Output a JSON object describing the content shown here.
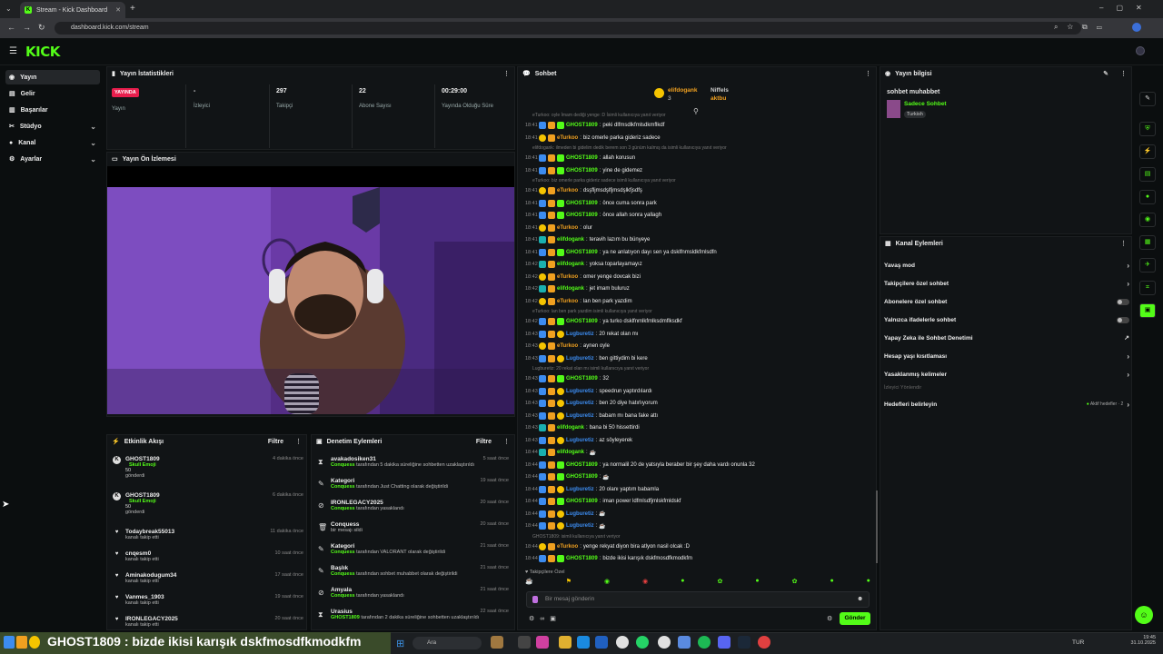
{
  "browser": {
    "tab_title": "Stream - Kick Dashboard",
    "url": "dashboard.kick.com/stream"
  },
  "brand": {
    "logo": "KICK",
    "accent": "#53fc18"
  },
  "sidebar": {
    "items": [
      {
        "label": "Yayın"
      },
      {
        "label": "Gelir"
      },
      {
        "label": "Başarılar"
      },
      {
        "label": "Stüdyo"
      },
      {
        "label": "Kanal"
      },
      {
        "label": "Ayarlar"
      }
    ]
  },
  "stats": {
    "title": "Yayın İstatistikleri",
    "live_badge": "YAYINDA",
    "items": [
      {
        "value": "",
        "label": "Yayın"
      },
      {
        "value": "-",
        "label": "İzleyici"
      },
      {
        "value": "297",
        "label": "Takipçi"
      },
      {
        "value": "22",
        "label": "Abone Sayısı"
      },
      {
        "value": "00:29:00",
        "label": "Yayında Olduğu Süre"
      }
    ]
  },
  "preview": {
    "title": "Yayın Ön İzlemesi"
  },
  "activity": {
    "title": "Etkinlik Akışı",
    "filter": "Filtre",
    "items": [
      {
        "user": "GHOST1809",
        "sub": "Skull Emoji",
        "amount": "50",
        "note": "gönderdi",
        "time": "4 dakika önce",
        "icon": "kick-icon"
      },
      {
        "user": "GHOST1809",
        "sub": "Skull Emoji",
        "amount": "50",
        "note": "gönderdi",
        "time": "6 dakika önce",
        "icon": "kick-icon"
      },
      {
        "user": "Todaybreak55013",
        "note": "kanalı takip etti",
        "time": "11 dakika önce",
        "icon": "heart-icon"
      },
      {
        "user": "cnqesm0",
        "note": "kanalı takip etti",
        "time": "10 saat önce",
        "icon": "heart-icon"
      },
      {
        "user": "Aminakodugum34",
        "note": "kanalı takip etti",
        "time": "17 saat önce",
        "icon": "heart-icon"
      },
      {
        "user": "Vanmes_1903",
        "note": "kanalı takip etti",
        "time": "19 saat önce",
        "icon": "heart-icon"
      },
      {
        "user": "IRONLEGACY2025",
        "note": "kanalı takip etti",
        "time": "20 saat önce",
        "icon": "heart-icon"
      }
    ]
  },
  "moderation": {
    "title": "Denetim Eylemleri",
    "filter": "Filtre",
    "items": [
      {
        "title": "avakadosiken31",
        "actor": "Conquess",
        "desc": "tarafından 5 dakika süreliğine sohbetten uzaklaştırıldı",
        "time": "5 saat önce"
      },
      {
        "title": "Kategori",
        "actor": "Conquess",
        "desc": "tarafından Just Chatting olarak değiştirildi",
        "time": "19 saat önce"
      },
      {
        "title": "IRONLEGACY2025",
        "actor": "Conquess",
        "desc": "tarafından yasaklandı",
        "time": "20 saat önce"
      },
      {
        "title": "Conquess",
        "actor": "",
        "desc": "bir mesajı sildi",
        "time": "20 saat önce"
      },
      {
        "title": "Kategori",
        "actor": "Conquess",
        "desc": "tarafından VALORANT olarak değiştirildi",
        "time": "21 saat önce"
      },
      {
        "title": "Başlık",
        "actor": "Conquess",
        "desc": "tarafından sohbet muhabbet olarak değiştirildi",
        "time": "21 saat önce"
      },
      {
        "title": "Amyala",
        "actor": "Conquess",
        "desc": "tarafından yasaklandı",
        "time": "21 saat önce"
      },
      {
        "title": "Urasius",
        "actor": "GHOST1809",
        "desc": "tarafından 2 dakika süreliğine sohbetten uzaklaştırıldı",
        "time": "22 saat önce"
      }
    ]
  },
  "chat": {
    "title": "Sohbet",
    "pinned": [
      {
        "user": "elifdogank",
        "count": "3"
      },
      {
        "user": "Niffels",
        "count": "1"
      },
      {
        "user": "aktbu",
        "count": "1"
      }
    ],
    "messages": [
      {
        "t": "18:41",
        "u": "GHOST1809",
        "c": "#53fc18",
        "m": "peki dlfmsdlkfmlsdkmflkdf",
        "r": "eTurkoo: oyle İmam dediği yenge :D İsimli kullanıcıya yanıt veriyor"
      },
      {
        "t": "18:41",
        "u": "eTurkoo",
        "c": "#f0a020",
        "m": "biz omerle parka gideriz sadece"
      },
      {
        "t": "18:41",
        "u": "GHOST1809",
        "c": "#53fc18",
        "m": "allah korusun",
        "r": "elifdogank: ilmeden bi gidelim dedik berem son 3 günüm kalmış da isimli kullanıcıya yanıt veriyor"
      },
      {
        "t": "18:41",
        "u": "GHOST1809",
        "c": "#53fc18",
        "m": "yine de gidemez"
      },
      {
        "t": "18:41",
        "u": "eTurkoo",
        "c": "#f0a020",
        "m": "dsşfljmsdşlfjmsdşlkfjsdfş",
        "r": "eTurkoo: biz omerle parka gideriz sadece isimli kullanıcıya yanıt veriyor"
      },
      {
        "t": "18:41",
        "u": "GHOST1809",
        "c": "#53fc18",
        "m": "önce cuma sonra park"
      },
      {
        "t": "18:41",
        "u": "GHOST1809",
        "c": "#53fc18",
        "m": "önce allah sonra yallagh"
      },
      {
        "t": "18:41",
        "u": "eTurkoo",
        "c": "#f0a020",
        "m": "olur"
      },
      {
        "t": "18:41",
        "u": "elifdogank",
        "c": "#53fc18",
        "m": "teravih lazım bu bünyeye"
      },
      {
        "t": "18:41",
        "u": "GHOST1809",
        "c": "#53fc18",
        "m": "ya ne anlatıyon dayı sen ya dsklfnmsldkfmlsdfn"
      },
      {
        "t": "18:42",
        "u": "elifdogank",
        "c": "#53fc18",
        "m": "yoksa toparlayamayız"
      },
      {
        "t": "18:42",
        "u": "eTurkoo",
        "c": "#f0a020",
        "m": "omer yenge dovcak bizi"
      },
      {
        "t": "18:42",
        "u": "elifdogank",
        "c": "#53fc18",
        "m": "jet imam buluruz"
      },
      {
        "t": "18:42",
        "u": "eTurkoo",
        "c": "#f0a020",
        "m": "lan ben park yazdim"
      },
      {
        "t": "18:42",
        "u": "GHOST1809",
        "c": "#53fc18",
        "m": "ya turko dsklfnmlkfmlksdmflksdkf",
        "r": "eTurkoo: lan ben park yazdim isimli kullanıcıya yanıt veriyor"
      },
      {
        "t": "18:43",
        "u": "Lugburetiz",
        "c": "#3c8cf0",
        "m": "20 rekat olan mı"
      },
      {
        "t": "18:43",
        "u": "eTurkoo",
        "c": "#f0a020",
        "m": "aynen oyle"
      },
      {
        "t": "18:43",
        "u": "Lugburetiz",
        "c": "#3c8cf0",
        "m": "ben gittiydim bi kere"
      },
      {
        "t": "18:43",
        "u": "GHOST1809",
        "c": "#53fc18",
        "m": "32",
        "r": "Lugburetiz: 20 rekat olan mı isimli kullanıcıya yanıt veriyor"
      },
      {
        "t": "18:43",
        "u": "Lugburetiz",
        "c": "#3c8cf0",
        "m": "speedrun yaptırdılardı"
      },
      {
        "t": "18:43",
        "u": "Lugburetiz",
        "c": "#3c8cf0",
        "m": "ben 20 diye hatırlıyorum"
      },
      {
        "t": "18:43",
        "u": "Lugburetiz",
        "c": "#3c8cf0",
        "m": "babam mı bana fake attı"
      },
      {
        "t": "18:43",
        "u": "elifdogank",
        "c": "#53fc18",
        "m": "bana bi 50 hissettirdi"
      },
      {
        "t": "18:43",
        "u": "Lugburetiz",
        "c": "#3c8cf0",
        "m": "az söyleyerek"
      },
      {
        "t": "18:44",
        "u": "elifdogank",
        "c": "#53fc18",
        "m": "☕"
      },
      {
        "t": "18:44",
        "u": "GHOST1809",
        "c": "#53fc18",
        "m": "ya normalil 20 de yatsıyla beraber bir şey daha vardı onunla 32"
      },
      {
        "t": "18:44",
        "u": "GHOST1809",
        "c": "#53fc18",
        "m": "☕"
      },
      {
        "t": "18:44",
        "u": "Lugburetiz",
        "c": "#3c8cf0",
        "m": "20 olanı yaptım babamla"
      },
      {
        "t": "18:44",
        "u": "GHOST1809",
        "c": "#53fc18",
        "m": "iman power ldfmlsdfjmlskfmldskf"
      },
      {
        "t": "18:44",
        "u": "Lugburetiz",
        "c": "#3c8cf0",
        "m": "☕"
      },
      {
        "t": "18:44",
        "u": "Lugburetiz",
        "c": "#3c8cf0",
        "m": "☕"
      },
      {
        "t": "18:44",
        "u": "eTurkoo",
        "c": "#f0a020",
        "m": "yenge rekyat diyon bira atlyon nasil olcak :D",
        "r": "GHOST1809: isimli kullanıcıya yanıt veriyor"
      },
      {
        "t": "18:44",
        "u": "GHOST1809",
        "c": "#53fc18",
        "m": "bizde ikisi karışık dskfmosdfkmodkfm"
      }
    ],
    "followers_only": "Takipçilere Özel",
    "input_placeholder": "Bir mesaj gönderin",
    "send": "Gönder"
  },
  "info": {
    "title": "Yayın bilgisi",
    "stream_title": "sohbet muhabbet",
    "category": "Sadece Sohbet",
    "tag": "Turkish"
  },
  "channel": {
    "title": "Kanal Eylemleri",
    "items": [
      {
        "label": "Yavaş mod",
        "kind": "chevron"
      },
      {
        "label": "Takipçilere özel sohbet",
        "kind": "chevron"
      },
      {
        "label": "Abonelere özel sohbet",
        "kind": "toggle"
      },
      {
        "label": "Yalnızca ifadelerle sohbet",
        "kind": "toggle"
      },
      {
        "label": "Yapay Zeka ile Sohbet Denetimi",
        "kind": "external"
      },
      {
        "label": "Hesap yaşı kısıtlaması",
        "kind": "chevron"
      },
      {
        "label": "Yasaklanmış kelimeler",
        "kind": "chevron"
      }
    ],
    "viewer_section": "İzleyici Yönlendir",
    "goals": "Hedefleri belirleyin",
    "goals_status": "Aktif hedefler · 2"
  },
  "overlay": {
    "text": "GHOST1809 : bizde ikisi karışık dskfmosdfkmodkfm"
  },
  "taskbar": {
    "search": "Ara",
    "lang": "TUR",
    "time": "19:45",
    "date": "31.10.2025"
  }
}
